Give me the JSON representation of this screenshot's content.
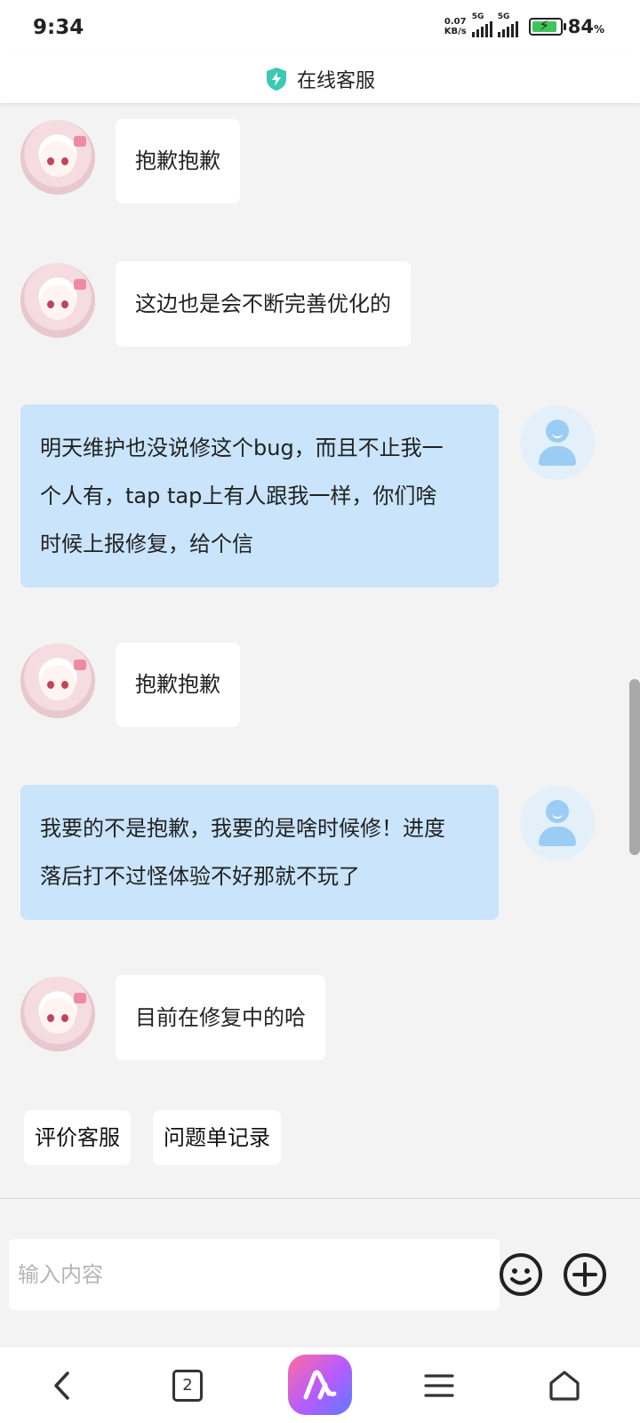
{
  "status_bar": {
    "time": "9:34",
    "net_speed_value": "0.07",
    "net_speed_unit": "KB/s",
    "signal_1_label": "5G",
    "signal_2_label": "5G",
    "battery_percent": "84",
    "battery_percent_sign": "%",
    "battery_level": 0.84
  },
  "header": {
    "title": "在线客服",
    "icon": "shield-bolt-icon",
    "accent": "#3cc8b4"
  },
  "messages": [
    {
      "from": "agent",
      "text": "抱歉抱歉"
    },
    {
      "from": "agent",
      "text": "这边也是会不断完善优化的"
    },
    {
      "from": "user",
      "lines": [
        "明天维护也没说修这个bug，而且不止我一",
        "个人有，tap tap上有人跟我一样，你们啥",
        "时候上报修复，给个信"
      ]
    },
    {
      "from": "agent",
      "text": "抱歉抱歉"
    },
    {
      "from": "user",
      "lines": [
        "我要的不是抱歉，我要的是啥时候修！进度",
        "落后打不过怪体验不好那就不玩了"
      ]
    },
    {
      "from": "agent",
      "text": "目前在修复中的哈"
    }
  ],
  "quick_actions": [
    {
      "label": "评价客服"
    },
    {
      "label": "问题单记录"
    }
  ],
  "input": {
    "placeholder": "输入内容",
    "emoji_icon": "emoji-icon",
    "add_icon": "plus-circle-icon"
  },
  "nav": {
    "tab_count": "2",
    "icons": [
      "back-icon",
      "tabs-icon",
      "app-logo-icon",
      "menu-icon",
      "home-icon"
    ]
  },
  "colors": {
    "user_bubble": "#c9e4fb",
    "agent_bubble": "#ffffff",
    "background": "#f3f3f3"
  }
}
